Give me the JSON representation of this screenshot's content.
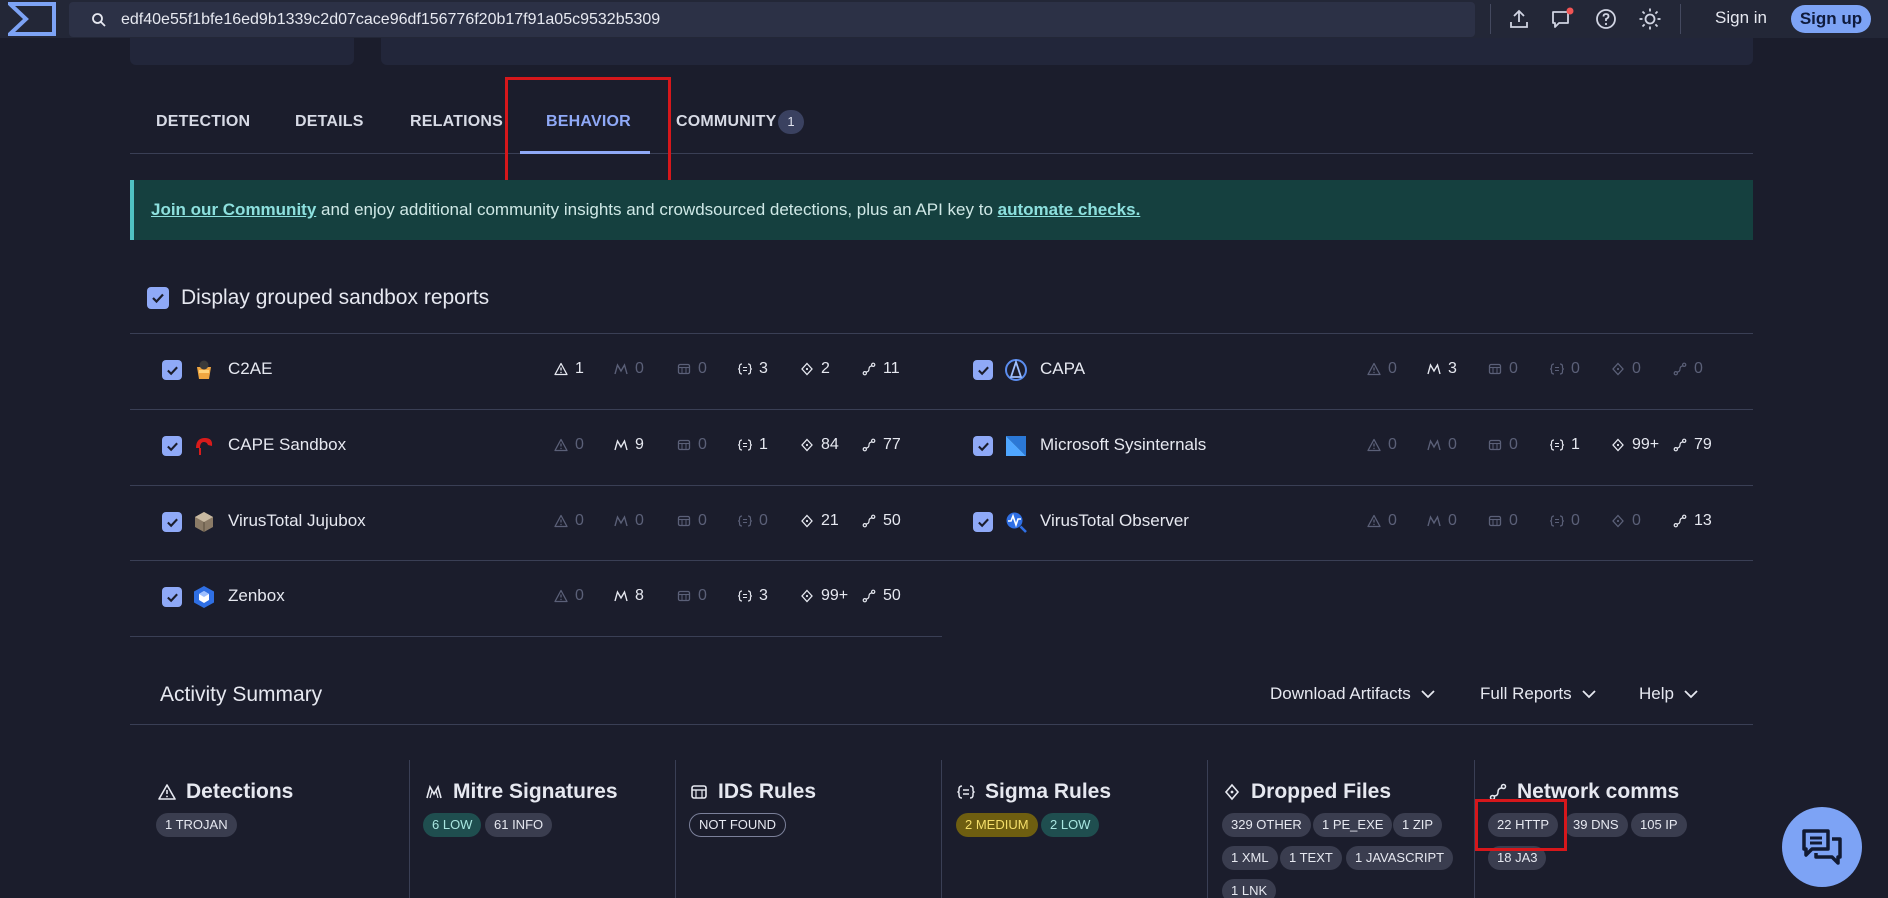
{
  "search": {
    "value": "edf40e55f1bfe16ed9b1339c2d07cace96df156776f20b17f91a05c9532b5309"
  },
  "header": {
    "sign_in": "Sign in",
    "sign_up": "Sign up"
  },
  "tabs": [
    {
      "label": "DETECTION"
    },
    {
      "label": "DETAILS"
    },
    {
      "label": "RELATIONS"
    },
    {
      "label": "BEHAVIOR",
      "active": true
    },
    {
      "label": "COMMUNITY",
      "badge": "1"
    }
  ],
  "banner": {
    "link1": "Join our Community",
    "middle": " and enjoy additional community insights and crowdsourced detections, plus an API key to ",
    "link2": "automate checks."
  },
  "grouped": {
    "label": "Display grouped sandbox reports",
    "checked": true
  },
  "sandboxes": [
    {
      "name": "C2AE",
      "stats": [
        "1",
        "0",
        "0",
        "3",
        "2",
        "11"
      ]
    },
    {
      "name": "CAPA",
      "stats": [
        "0",
        "3",
        "0",
        "0",
        "0",
        "0"
      ]
    },
    {
      "name": "CAPE Sandbox",
      "stats": [
        "0",
        "9",
        "0",
        "1",
        "84",
        "77"
      ]
    },
    {
      "name": "Microsoft Sysinternals",
      "stats": [
        "0",
        "0",
        "0",
        "1",
        "99+",
        "79"
      ]
    },
    {
      "name": "VirusTotal Jujubox",
      "stats": [
        "0",
        "0",
        "0",
        "0",
        "21",
        "50"
      ]
    },
    {
      "name": "VirusTotal Observer",
      "stats": [
        "0",
        "0",
        "0",
        "0",
        "0",
        "13"
      ]
    },
    {
      "name": "Zenbox",
      "stats": [
        "0",
        "8",
        "0",
        "3",
        "99+",
        "50"
      ]
    }
  ],
  "activity": {
    "title": "Activity Summary",
    "download_artifacts": "Download Artifacts",
    "full_reports": "Full Reports",
    "help": "Help"
  },
  "summary": {
    "detections": {
      "title": "Detections",
      "tags": [
        "1 TROJAN"
      ]
    },
    "mitre": {
      "title": "Mitre Signatures",
      "tags": [
        "6 LOW",
        "61 INFO"
      ]
    },
    "ids": {
      "title": "IDS Rules",
      "tags": [
        "NOT FOUND"
      ]
    },
    "sigma": {
      "title": "Sigma Rules",
      "tags": [
        "2 MEDIUM",
        "2 LOW"
      ]
    },
    "dropped": {
      "title": "Dropped Files",
      "tags": [
        "329 OTHER",
        "1 PE_EXE",
        "1 ZIP",
        "1 XML",
        "1 TEXT",
        "1 JAVASCRIPT",
        "1 LNK"
      ]
    },
    "network": {
      "title": "Network comms",
      "tags": [
        "22 HTTP",
        "39 DNS",
        "105 IP",
        "18 JA3"
      ]
    }
  },
  "colors": {
    "accent": "#8fa9f7",
    "annotation": "#d6171b",
    "banner_bg": "#15403f"
  }
}
